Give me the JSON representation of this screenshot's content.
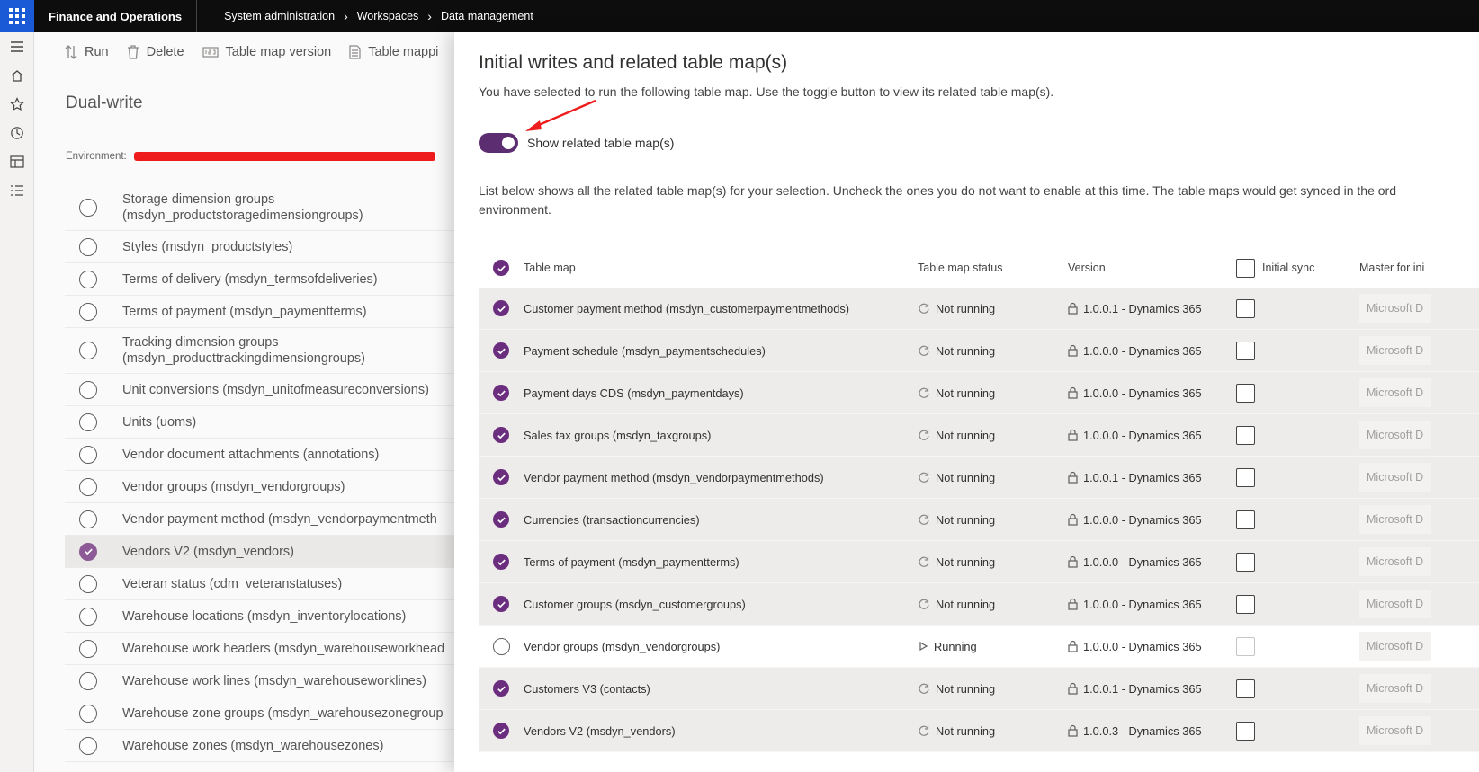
{
  "topbar": {
    "app_title": "Finance and Operations",
    "breadcrumbs": [
      "System administration",
      "Workspaces",
      "Data management"
    ]
  },
  "rail": {
    "icons": [
      "hamburger-icon",
      "home-icon",
      "star-icon",
      "clock-icon",
      "workspace-icon",
      "list-icon"
    ]
  },
  "bg": {
    "toolbar": {
      "run": "Run",
      "delete": "Delete",
      "version": "Table map version",
      "mapping": "Table mappi"
    },
    "title": "Dual-write",
    "environment_label": "Environment:",
    "items": [
      {
        "label": "Storage dimension groups\n(msdyn_productstoragedimensiongroups)",
        "tall": true,
        "selected": false
      },
      {
        "label": "Styles (msdyn_productstyles)",
        "tall": false,
        "selected": false
      },
      {
        "label": "Terms of delivery (msdyn_termsofdeliveries)",
        "tall": false,
        "selected": false
      },
      {
        "label": "Terms of payment (msdyn_paymentterms)",
        "tall": false,
        "selected": false
      },
      {
        "label": "Tracking dimension groups\n(msdyn_producttrackingdimensiongroups)",
        "tall": true,
        "selected": false
      },
      {
        "label": "Unit conversions (msdyn_unitofmeasureconversions)",
        "tall": false,
        "selected": false
      },
      {
        "label": "Units (uoms)",
        "tall": false,
        "selected": false
      },
      {
        "label": "Vendor document attachments (annotations)",
        "tall": false,
        "selected": false
      },
      {
        "label": "Vendor groups (msdyn_vendorgroups)",
        "tall": false,
        "selected": false
      },
      {
        "label": "Vendor payment method (msdyn_vendorpaymentmeth",
        "tall": false,
        "selected": false
      },
      {
        "label": "Vendors V2 (msdyn_vendors)",
        "tall": false,
        "selected": true
      },
      {
        "label": "Veteran status (cdm_veteranstatuses)",
        "tall": false,
        "selected": false
      },
      {
        "label": "Warehouse locations (msdyn_inventorylocations)",
        "tall": false,
        "selected": false
      },
      {
        "label": "Warehouse work headers (msdyn_warehouseworkhead",
        "tall": false,
        "selected": false
      },
      {
        "label": "Warehouse work lines (msdyn_warehouseworklines)",
        "tall": false,
        "selected": false
      },
      {
        "label": "Warehouse zone groups (msdyn_warehousezonegroup",
        "tall": false,
        "selected": false
      },
      {
        "label": "Warehouse zones (msdyn_warehousezones)",
        "tall": false,
        "selected": false
      }
    ]
  },
  "panel": {
    "title": "Initial writes and related table map(s)",
    "subtitle": "You have selected to run the following table map. Use the toggle button to view its related table map(s).",
    "toggle_label": "Show related table map(s)",
    "toggle_on": true,
    "description_line1": "List below shows all the related table map(s) for your selection. Uncheck the ones you do not want to enable at this time. The table maps would get synced in the ord",
    "description_line2": "environment.",
    "columns": {
      "table_map": "Table map",
      "status": "Table map status",
      "version": "Version",
      "initial_sync": "Initial sync",
      "master": "Master for ini"
    },
    "master_placeholder": "Microsoft D",
    "rows": [
      {
        "map": "Customer payment method (msdyn_customerpaymentmethods)",
        "status": "Not running",
        "version": "1.0.0.1 - Dynamics 365",
        "selected": true
      },
      {
        "map": "Payment schedule (msdyn_paymentschedules)",
        "status": "Not running",
        "version": "1.0.0.0 - Dynamics 365",
        "selected": true
      },
      {
        "map": "Payment days CDS (msdyn_paymentdays)",
        "status": "Not running",
        "version": "1.0.0.0 - Dynamics 365",
        "selected": true
      },
      {
        "map": "Sales tax groups (msdyn_taxgroups)",
        "status": "Not running",
        "version": "1.0.0.0 - Dynamics 365",
        "selected": true
      },
      {
        "map": "Vendor payment method (msdyn_vendorpaymentmethods)",
        "status": "Not running",
        "version": "1.0.0.1 - Dynamics 365",
        "selected": true
      },
      {
        "map": "Currencies (transactioncurrencies)",
        "status": "Not running",
        "version": "1.0.0.0 - Dynamics 365",
        "selected": true
      },
      {
        "map": "Terms of payment (msdyn_paymentterms)",
        "status": "Not running",
        "version": "1.0.0.0 - Dynamics 365",
        "selected": true
      },
      {
        "map": "Customer groups (msdyn_customergroups)",
        "status": "Not running",
        "version": "1.0.0.0 - Dynamics 365",
        "selected": true
      },
      {
        "map": "Vendor groups (msdyn_vendorgroups)",
        "status": "Running",
        "version": "1.0.0.0 - Dynamics 365",
        "selected": false
      },
      {
        "map": "Customers V3 (contacts)",
        "status": "Not running",
        "version": "1.0.0.1 - Dynamics 365",
        "selected": true
      },
      {
        "map": "Vendors V2 (msdyn_vendors)",
        "status": "Not running",
        "version": "1.0.0.3 - Dynamics 365",
        "selected": true
      }
    ]
  },
  "colors": {
    "accent": "#6b2e7f",
    "toggle": "#5c2e71",
    "topbar": "#0d0d0d",
    "waffle": "#1a5ad6",
    "annotation": "#ee1c1c"
  }
}
